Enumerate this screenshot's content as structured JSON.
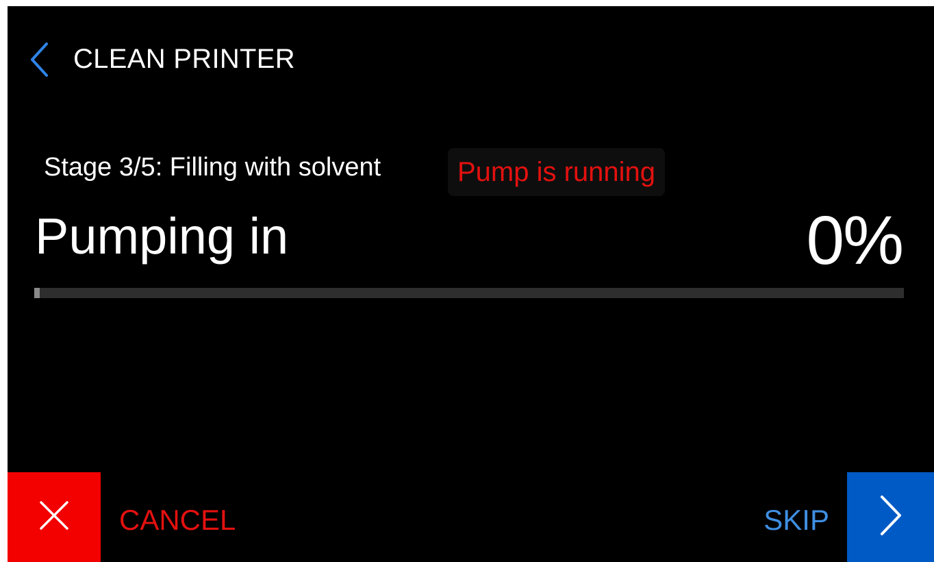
{
  "header": {
    "title": "CLEAN PRINTER",
    "back_icon": "chevron-left-icon"
  },
  "stage": {
    "label": "Stage 3/5: Filling with solvent",
    "status": "Pump is running"
  },
  "operation": {
    "label": "Pumping in",
    "percent_text": "0%",
    "progress": 0
  },
  "footer": {
    "cancel_label": "CANCEL",
    "cancel_icon": "close-icon",
    "skip_label": "SKIP",
    "next_icon": "chevron-right-icon"
  },
  "colors": {
    "background": "#000000",
    "accent_blue": "#005ac6",
    "skip_blue": "#3f8fe3",
    "danger_red": "#f30000",
    "status_red": "#e3110f",
    "text": "#ffffff"
  }
}
